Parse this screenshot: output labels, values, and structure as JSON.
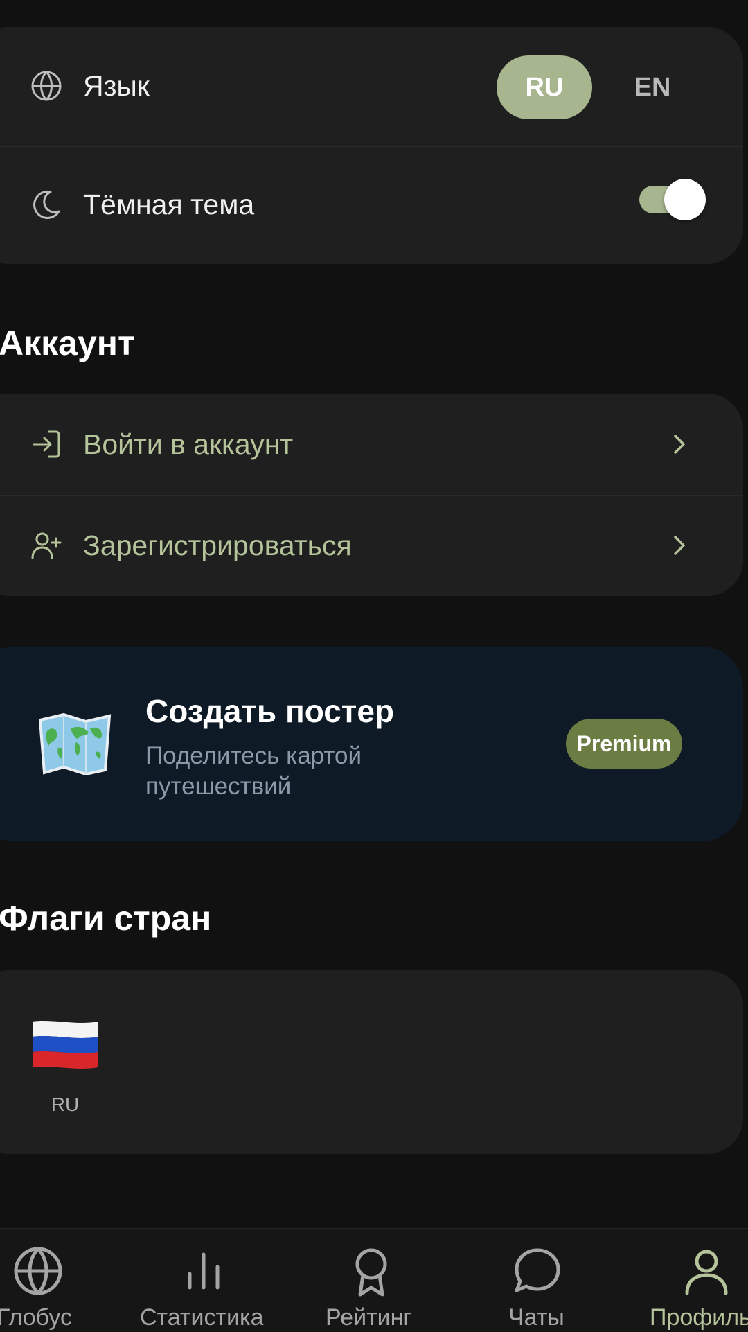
{
  "settings": {
    "language_label": "Язык",
    "lang_active": "RU",
    "lang_other": "EN",
    "dark_theme_label": "Тёмная тема",
    "dark_theme_on": true
  },
  "account": {
    "title": "Аккаунт",
    "login_label": "Войти в аккаунт",
    "register_label": "Зарегистрироваться"
  },
  "promo": {
    "title": "Создать постер",
    "subtitle_line1": "Поделитесь картой",
    "subtitle_line2": "путешествий",
    "premium_label": "Premium"
  },
  "flags": {
    "title": "Флаги стран",
    "items": [
      {
        "code": "RU"
      }
    ]
  },
  "tabbar": {
    "tabs": [
      {
        "label": "Глобус",
        "icon": "globe-icon",
        "active": false
      },
      {
        "label": "Статистика",
        "icon": "bar-chart-icon",
        "active": false
      },
      {
        "label": "Рейтинг",
        "icon": "award-icon",
        "active": false
      },
      {
        "label": "Чаты",
        "icon": "chat-bubble-icon",
        "active": false
      },
      {
        "label": "Профиль",
        "icon": "user-icon",
        "active": true
      }
    ]
  },
  "colors": {
    "accent": "#a8b68f",
    "accent_text": "#b4c39a",
    "premium": "#6c7d43",
    "promo_bg": "#0f1a27"
  }
}
